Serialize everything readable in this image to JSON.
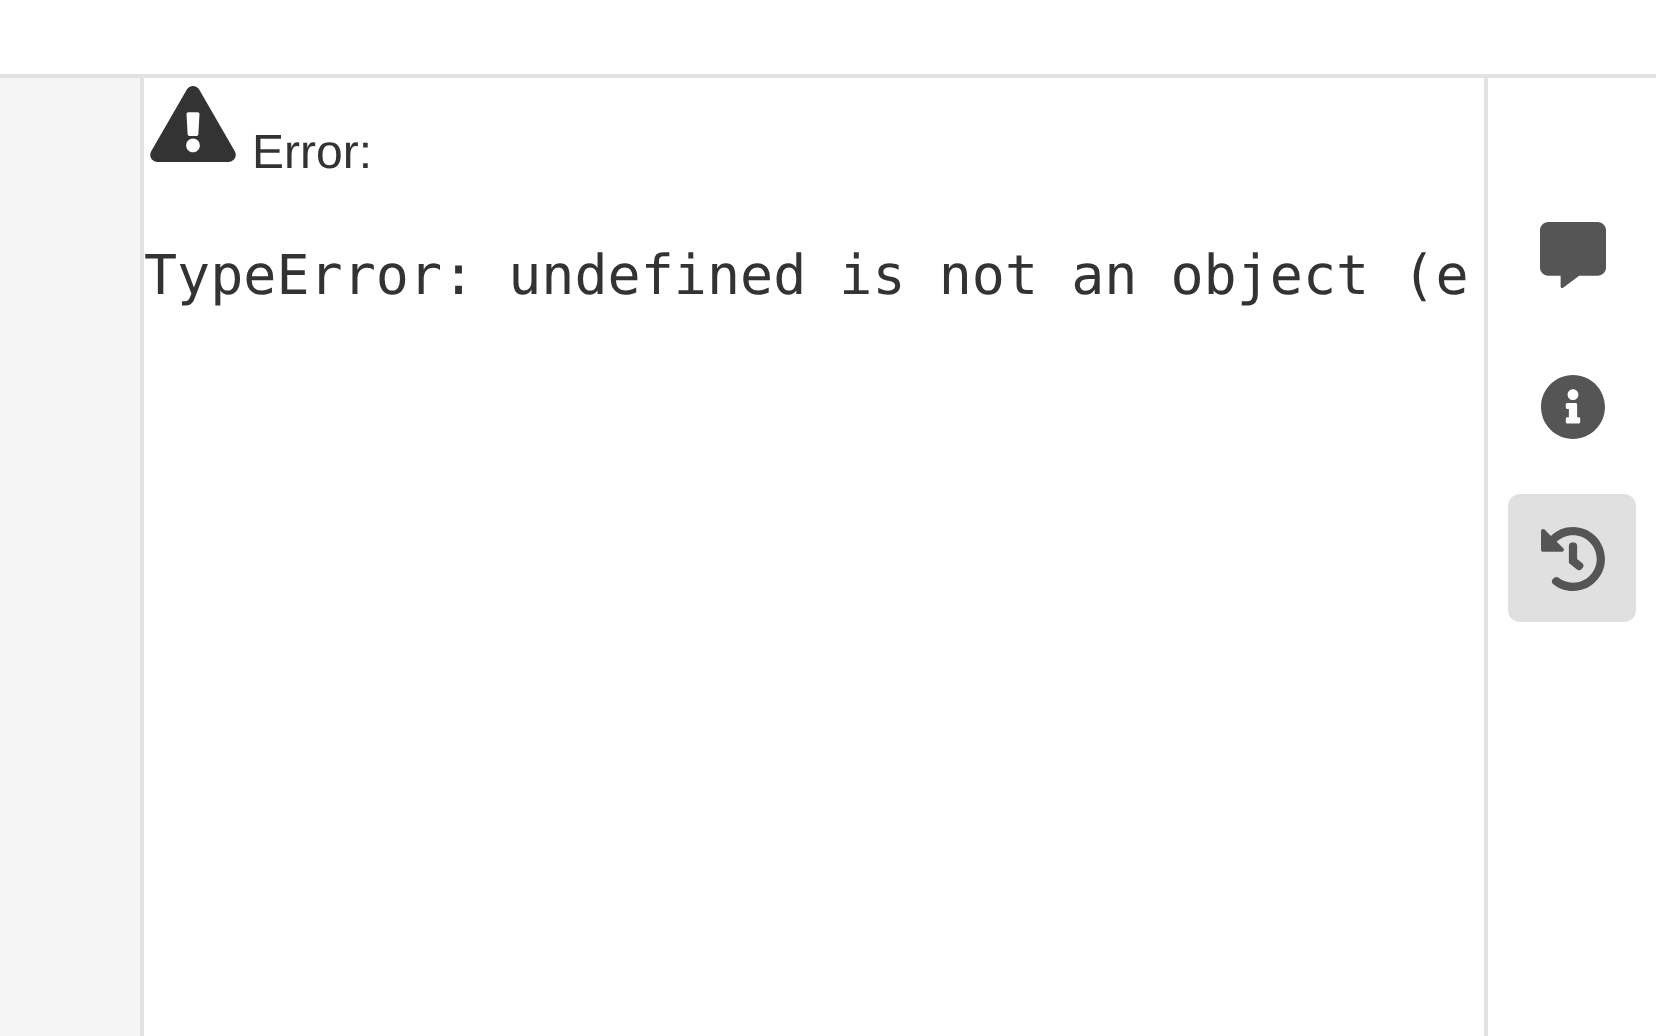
{
  "error": {
    "title": "Error:",
    "message": "TypeError: undefined is not an object (e"
  },
  "sidebar": {
    "items": [
      {
        "kind": "comment",
        "selected": false
      },
      {
        "kind": "info",
        "selected": false
      },
      {
        "kind": "history",
        "selected": true
      }
    ]
  }
}
